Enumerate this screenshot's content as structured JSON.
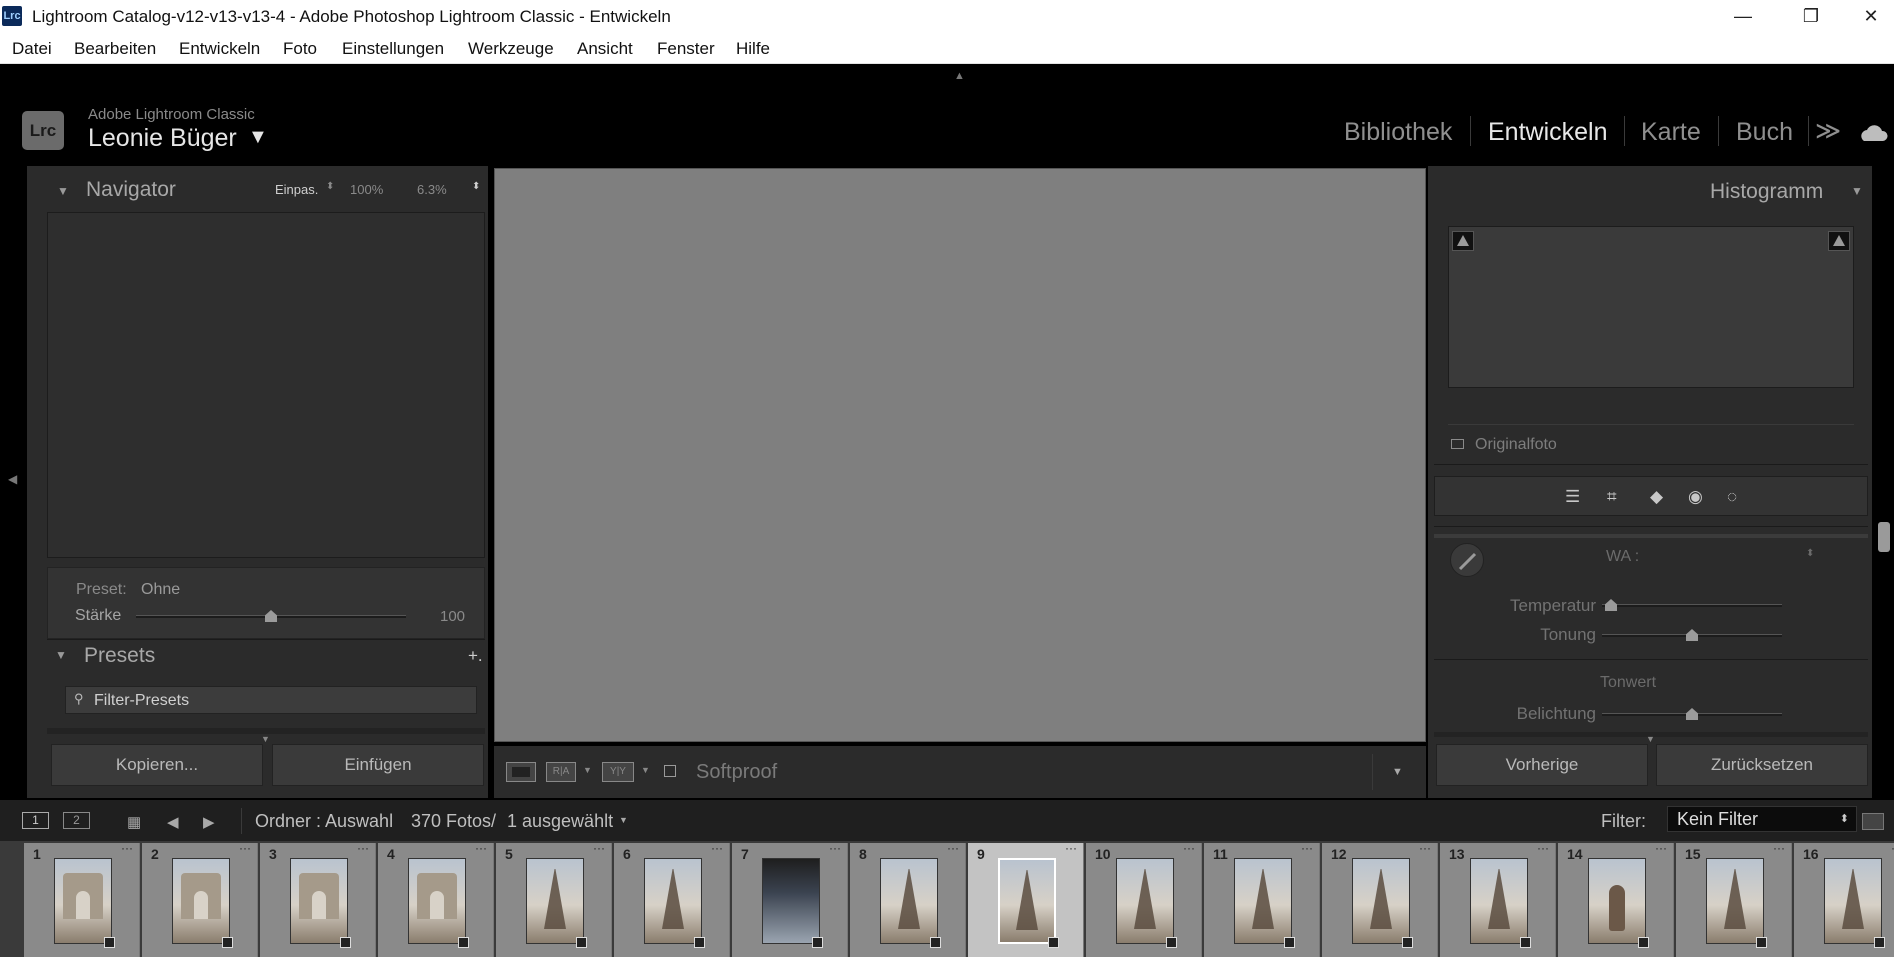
{
  "window": {
    "app_icon": "Lrc",
    "title": "Lightroom Catalog-v12-v13-v13-4 - Adobe Photoshop Lightroom Classic - Entwickeln",
    "minimize": "—",
    "maximize": "❐",
    "close": "✕"
  },
  "menu": [
    "Datei",
    "Bearbeiten",
    "Entwickeln",
    "Foto",
    "Einstellungen",
    "Werkzeuge",
    "Ansicht",
    "Fenster",
    "Hilfe"
  ],
  "identity": {
    "badge": "Lrc",
    "product": "Adobe Lightroom Classic",
    "user": "Leonie Büger",
    "caret": "▼"
  },
  "modules": [
    "Bibliothek",
    "Entwickeln",
    "Karte",
    "Buch"
  ],
  "active_module": "Entwickeln",
  "module_more": "≫",
  "navigator": {
    "title": "Navigator",
    "fit": "Einpas.",
    "zoom1": "100%",
    "zoom2": "6.3%"
  },
  "preset_box": {
    "preset_label": "Preset:",
    "preset_value": "Ohne",
    "strength_label": "Stärke",
    "strength_value": "100",
    "strength_level": 0.5
  },
  "presets": {
    "title": "Presets",
    "add": "+.",
    "filter_placeholder": "Filter-Presets"
  },
  "left_buttons": {
    "copy": "Kopieren...",
    "paste": "Einfügen"
  },
  "toolbar": {
    "view_ra": "R|A",
    "view_yy": "Y|Y",
    "softproof": "Softproof"
  },
  "histogram": {
    "title": "Histogramm",
    "original_photo": "Originalfoto"
  },
  "basic": {
    "wb_label": "WA :",
    "temperature": "Temperatur",
    "temperature_level": 0.05,
    "tint": "Tonung",
    "tint_level": 0.5,
    "tone_header": "Tonwert",
    "exposure": "Belichtung",
    "exposure_level": 0.5
  },
  "right_buttons": {
    "previous": "Vorherige",
    "reset": "Zurücksetzen"
  },
  "filmstrip_header": {
    "screen1": "1",
    "screen2": "2",
    "source": "Ordner : Auswahl",
    "count": "370 Fotos/",
    "selected": "1 ausgewählt",
    "filter_label": "Filter:",
    "filter_value": "Kein Filter"
  },
  "filmstrip": [
    {
      "num": "1",
      "kind": "arch"
    },
    {
      "num": "2",
      "kind": "arch"
    },
    {
      "num": "3",
      "kind": "arch"
    },
    {
      "num": "4",
      "kind": "arch"
    },
    {
      "num": "5",
      "kind": "tower"
    },
    {
      "num": "6",
      "kind": "tower"
    },
    {
      "num": "7",
      "kind": "dark"
    },
    {
      "num": "8",
      "kind": "tower"
    },
    {
      "num": "9",
      "kind": "tower",
      "selected": true
    },
    {
      "num": "10",
      "kind": "tower"
    },
    {
      "num": "11",
      "kind": "tower"
    },
    {
      "num": "12",
      "kind": "tower"
    },
    {
      "num": "13",
      "kind": "tower"
    },
    {
      "num": "14",
      "kind": "person"
    },
    {
      "num": "15",
      "kind": "tower"
    },
    {
      "num": "16",
      "kind": "tower"
    }
  ]
}
